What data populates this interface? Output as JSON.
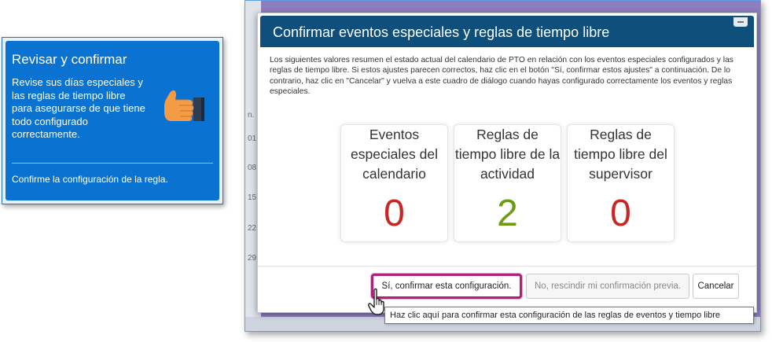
{
  "tip_card": {
    "title": "Revisar y confirmar",
    "body": "Revise sus días especiales y las reglas de tiempo libre para asegurarse de que tiene todo configurado correctamente.",
    "footer": "Confirme la configuración de la regla."
  },
  "background": {
    "row_numbers": [
      "n.",
      "01",
      "08",
      "15",
      "22",
      "29"
    ]
  },
  "dialog": {
    "title": "Confirmar eventos especiales y reglas de tiempo libre",
    "description": "Los siguientes valores resumen el estado actual del calendario de PTO en relación con los eventos especiales configurados y las reglas de tiempo libre. Si estos ajustes parecen correctos, haz clic en el botón \"Sí, confirmar estos ajustes\" a continuación. De lo contrario, haz clic en \"Cancelar\" y vuelva a este cuadro de diálogo cuando hayas configurado correctamente los eventos y reglas especiales.",
    "stats": [
      {
        "label": "Eventos especiales del calendario",
        "value": "0",
        "color": "#c62828"
      },
      {
        "label": "Reglas de tiempo libre de la actividad",
        "value": "2",
        "color": "#6e9a12"
      },
      {
        "label": "Reglas de tiempo libre del supervisor",
        "value": "0",
        "color": "#c62828"
      }
    ],
    "buttons": {
      "confirm": "Sí, confirmar esta configuración.",
      "rescind": "No, rescindir mi confirmación previa.",
      "cancel": "Cancelar"
    },
    "tooltip": "Haz clic aquí para confirmar esta configuración de las reglas de eventos y tiempo libre"
  },
  "colors": {
    "tip_blue": "#0a72d0",
    "header_navy": "#0e4f7c",
    "highlight_magenta": "#b0207b",
    "background_purple": "#8e7ebf"
  },
  "icons": {
    "thumb": "thumbs-up-icon",
    "cursor": "hand-pointer-icon",
    "close": "close-icon"
  }
}
